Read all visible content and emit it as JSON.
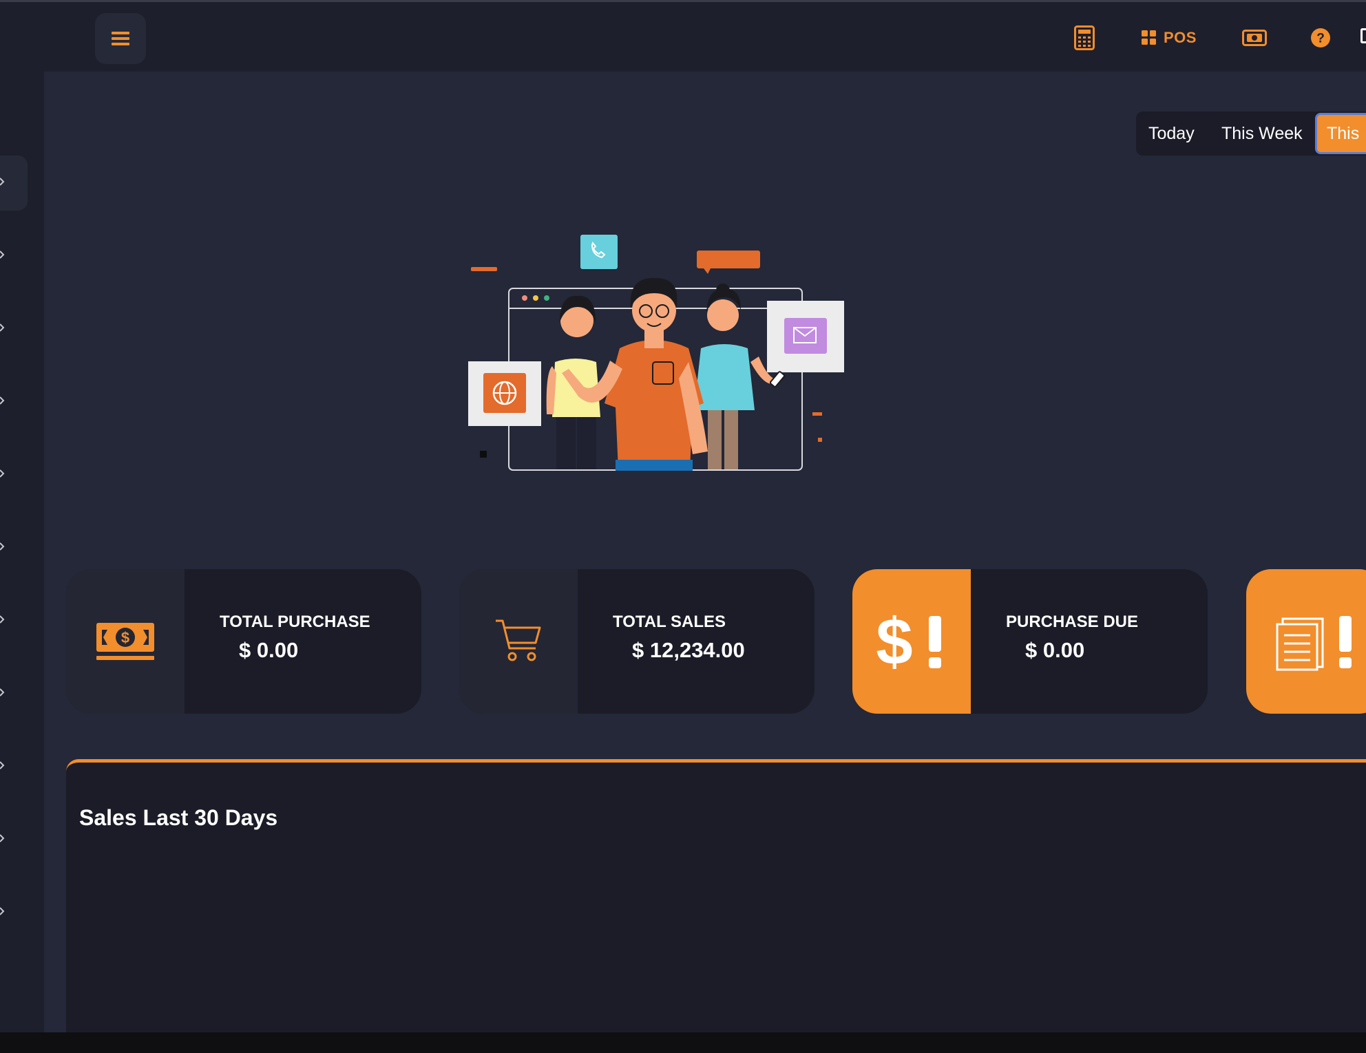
{
  "topbar": {
    "menu_icon": "hamburger-icon",
    "calculator_icon": "calculator-icon",
    "pos_icon": "grid-icon",
    "pos_label": "POS",
    "cash_icon": "money-icon",
    "help_icon": "help-icon"
  },
  "date_range": {
    "options": [
      "Today",
      "This Week"
    ],
    "active": "This"
  },
  "stats": [
    {
      "label": "TOTAL PURCHASE",
      "value": "$ 0.00",
      "icon": "cash-bill-icon"
    },
    {
      "label": "TOTAL SALES",
      "value": "$ 12,234.00",
      "icon": "shopping-cart-icon"
    },
    {
      "label": "PURCHASE DUE",
      "value": "$ 0.00",
      "icon": "dollar-alert-icon"
    },
    {
      "label": "",
      "value": "",
      "icon": "invoice-alert-icon"
    }
  ],
  "sales_panel": {
    "title": "Sales Last 30 Days"
  },
  "colors": {
    "accent": "#f28e2c",
    "background": "#242838",
    "topbar": "#1e1f2c",
    "card": "#1b1c27"
  }
}
